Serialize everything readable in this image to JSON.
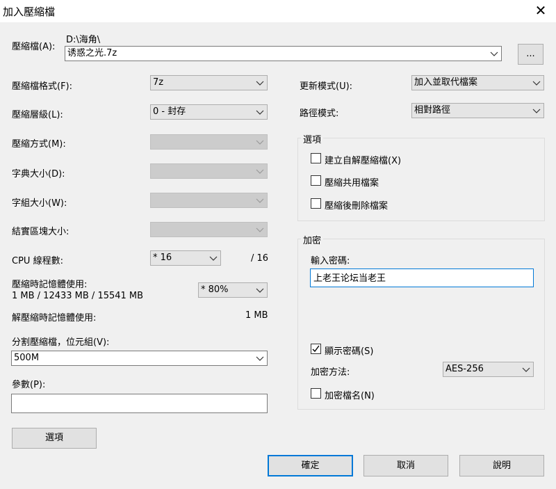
{
  "window": {
    "title": "加入壓縮檔",
    "close_glyph": "✕"
  },
  "archive": {
    "label": "壓縮檔(A):",
    "path": "D:\\海角\\",
    "filename": "诱惑之光.7z",
    "browse_label": "..."
  },
  "left": {
    "format": {
      "label": "壓縮檔格式(F):",
      "value": "7z"
    },
    "level": {
      "label": "壓縮層級(L):",
      "value": "0 - 封存"
    },
    "method": {
      "label": "壓縮方式(M):",
      "value": ""
    },
    "dict": {
      "label": "字典大小(D):",
      "value": ""
    },
    "word": {
      "label": "字組大小(W):",
      "value": ""
    },
    "solid": {
      "label": "結實區塊大小:",
      "value": ""
    },
    "cpu": {
      "label": "CPU 線程數:",
      "value": "* 16",
      "total": "/ 16"
    },
    "mem_compress": {
      "label": "壓縮時記憶體使用:",
      "detail": "1 MB / 12433 MB / 15541 MB",
      "value": "* 80%"
    },
    "mem_decompress": {
      "label": "解壓縮時記憶體使用:",
      "value": "1 MB"
    },
    "split": {
      "label": "分割壓縮檔，位元組(V):",
      "value": "500M"
    },
    "params": {
      "label": "參數(P):",
      "value": ""
    },
    "options_button": "選項"
  },
  "right": {
    "update": {
      "label": "更新模式(U):",
      "value": "加入並取代檔案"
    },
    "path_mode": {
      "label": "路徑模式:",
      "value": "相對路徑"
    },
    "options_group": {
      "title": "選項",
      "sfx": {
        "label": "建立自解壓縮檔(X)",
        "checked": false
      },
      "shared": {
        "label": "壓縮共用檔案",
        "checked": false
      },
      "delete": {
        "label": "壓縮後刪除檔案",
        "checked": false
      }
    },
    "encryption": {
      "title": "加密",
      "password_label": "輸入密碼:",
      "password": "上老王论坛当老王",
      "show_password": {
        "label": "顯示密碼(S)",
        "checked": true
      },
      "method_label": "加密方法:",
      "method_value": "AES-256",
      "encrypt_names": {
        "label": "加密檔名(N)",
        "checked": false
      }
    }
  },
  "buttons": {
    "ok": "確定",
    "cancel": "取消",
    "help": "說明"
  }
}
